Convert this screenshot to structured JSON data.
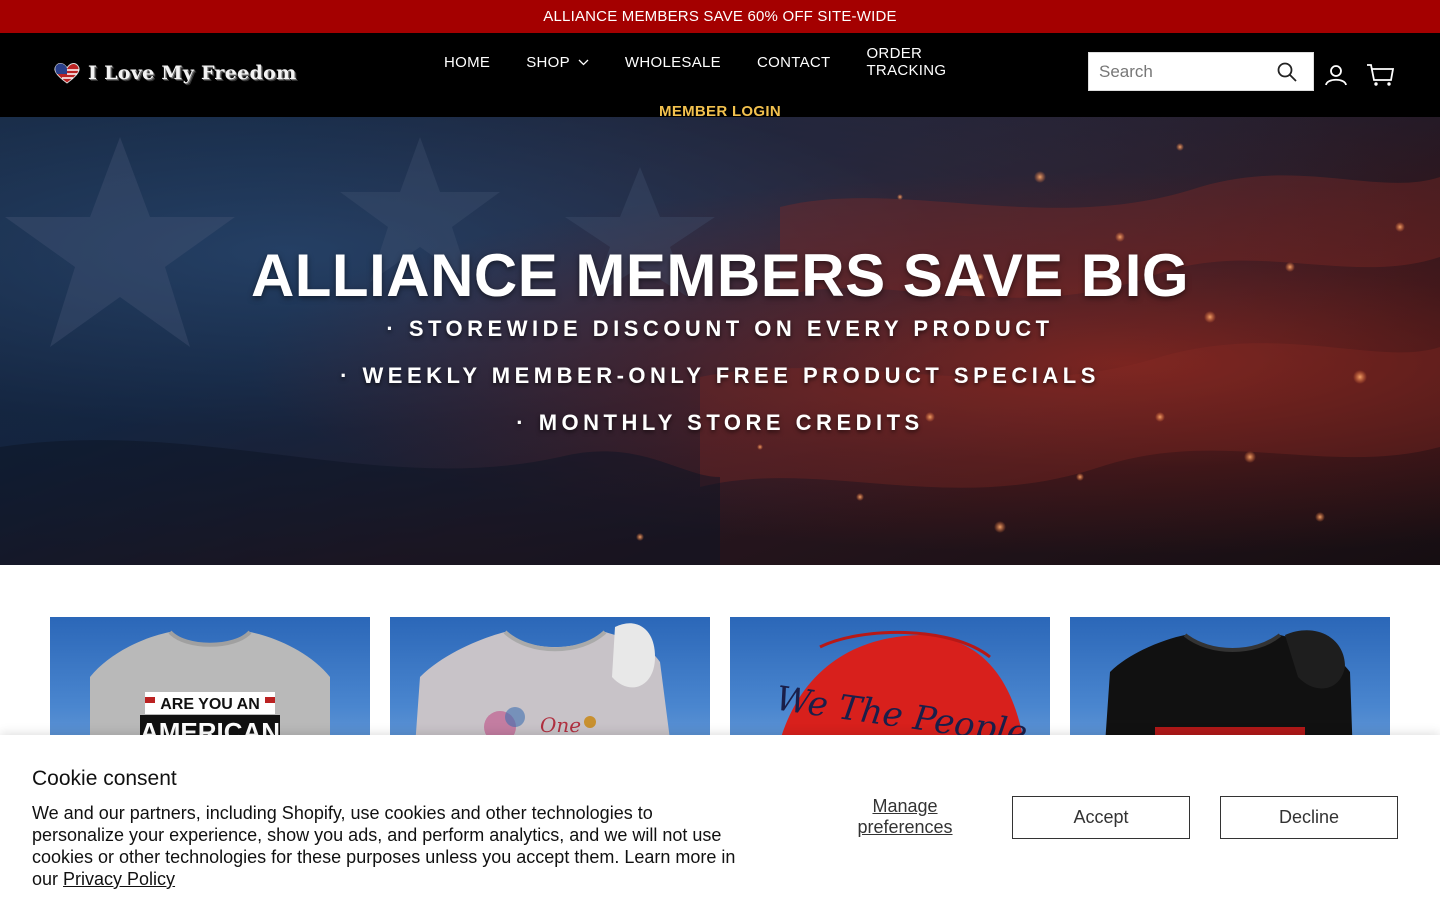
{
  "announcement": "ALLIANCE MEMBERS SAVE 60% OFF SITE-WIDE",
  "brand": {
    "logo_text": "I Love My Freedom"
  },
  "nav": {
    "items": [
      {
        "label": "HOME"
      },
      {
        "label": "SHOP"
      },
      {
        "label": "WHOLESALE"
      },
      {
        "label": "CONTACT"
      },
      {
        "label": "ORDER TRACKING"
      }
    ],
    "member_login": "MEMBER LOGIN"
  },
  "search": {
    "placeholder": "Search"
  },
  "icons": {
    "search": "search-icon",
    "account": "account-icon",
    "cart": "cart-icon",
    "shop_dropdown": "chevron-down-icon"
  },
  "hero": {
    "title": "ALLIANCE MEMBERS SAVE BIG",
    "bullets": [
      "· STOREWIDE DISCOUNT ON EVERY PRODUCT",
      "· WEEKLY MEMBER-ONLY FREE PRODUCT SPECIALS",
      "· MONTHLY STORE CREDITS"
    ]
  },
  "products": [
    {
      "image": "gray t-shirt with 'ARE YOU AN AMERICAN' print",
      "print_text": "ARE YOU AN AMERICAN"
    },
    {
      "image": "gray sweatshirt with floral print"
    },
    {
      "image": "red cap with 'We The People' embroidery",
      "print_text": "We The People"
    },
    {
      "image": "black t-shirt with red print"
    }
  ],
  "cookie": {
    "title": "Cookie consent",
    "body": "We and our partners, including Shopify, use cookies and other technologies to personalize your experience, show you ads, and perform analytics, and we will not use cookies or other technologies for these purposes unless you accept them. Learn more in our ",
    "policy_link": "Privacy Policy",
    "manage": "Manage preferences",
    "accept": "Accept",
    "decline": "Decline"
  },
  "colors": {
    "announcement_bg": "#a40000",
    "header_bg": "#000000",
    "member_login": "#f2c14e"
  }
}
